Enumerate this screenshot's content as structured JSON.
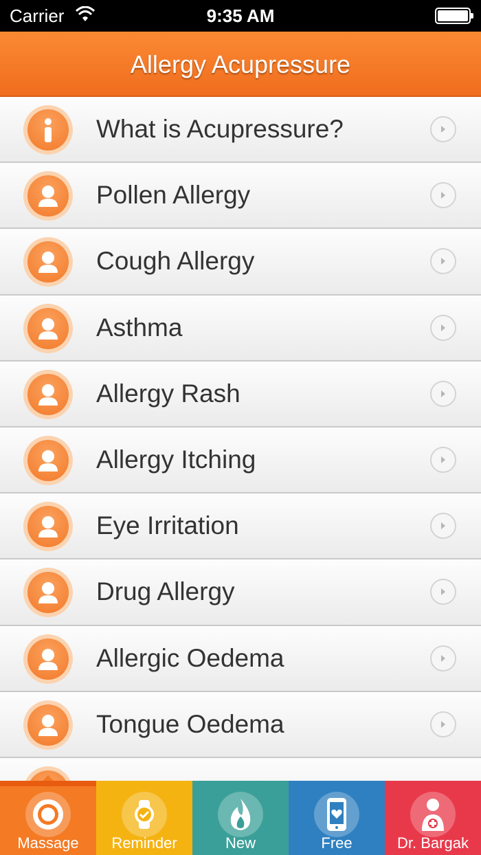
{
  "status_bar": {
    "carrier": "Carrier",
    "time": "9:35 AM"
  },
  "nav": {
    "title": "Allergy Acupressure"
  },
  "list": {
    "items": [
      {
        "label": "What is Acupressure?",
        "icon": "info-icon"
      },
      {
        "label": "Pollen Allergy",
        "icon": "person-icon"
      },
      {
        "label": "Cough Allergy",
        "icon": "person-icon"
      },
      {
        "label": "Asthma",
        "icon": "person-icon"
      },
      {
        "label": "Allergy Rash",
        "icon": "person-icon"
      },
      {
        "label": "Allergy Itching",
        "icon": "person-icon"
      },
      {
        "label": "Eye Irritation",
        "icon": "person-icon"
      },
      {
        "label": "Drug Allergy",
        "icon": "person-icon"
      },
      {
        "label": "Allergic Oedema",
        "icon": "person-icon"
      },
      {
        "label": "Tongue Oedema",
        "icon": "person-icon"
      }
    ]
  },
  "tabs": [
    {
      "label": "Massage",
      "icon": "target-icon",
      "color": "#f47a24",
      "active": true
    },
    {
      "label": "Reminder",
      "icon": "watch-check-icon",
      "color": "#f5b312",
      "active": false
    },
    {
      "label": "New",
      "icon": "flame-icon",
      "color": "#3a9f98",
      "active": false
    },
    {
      "label": "Free",
      "icon": "phone-heart-icon",
      "color": "#2f80c0",
      "active": false
    },
    {
      "label": "Dr. Bargak",
      "icon": "doctor-icon",
      "color": "#e8394a",
      "active": false
    }
  ]
}
